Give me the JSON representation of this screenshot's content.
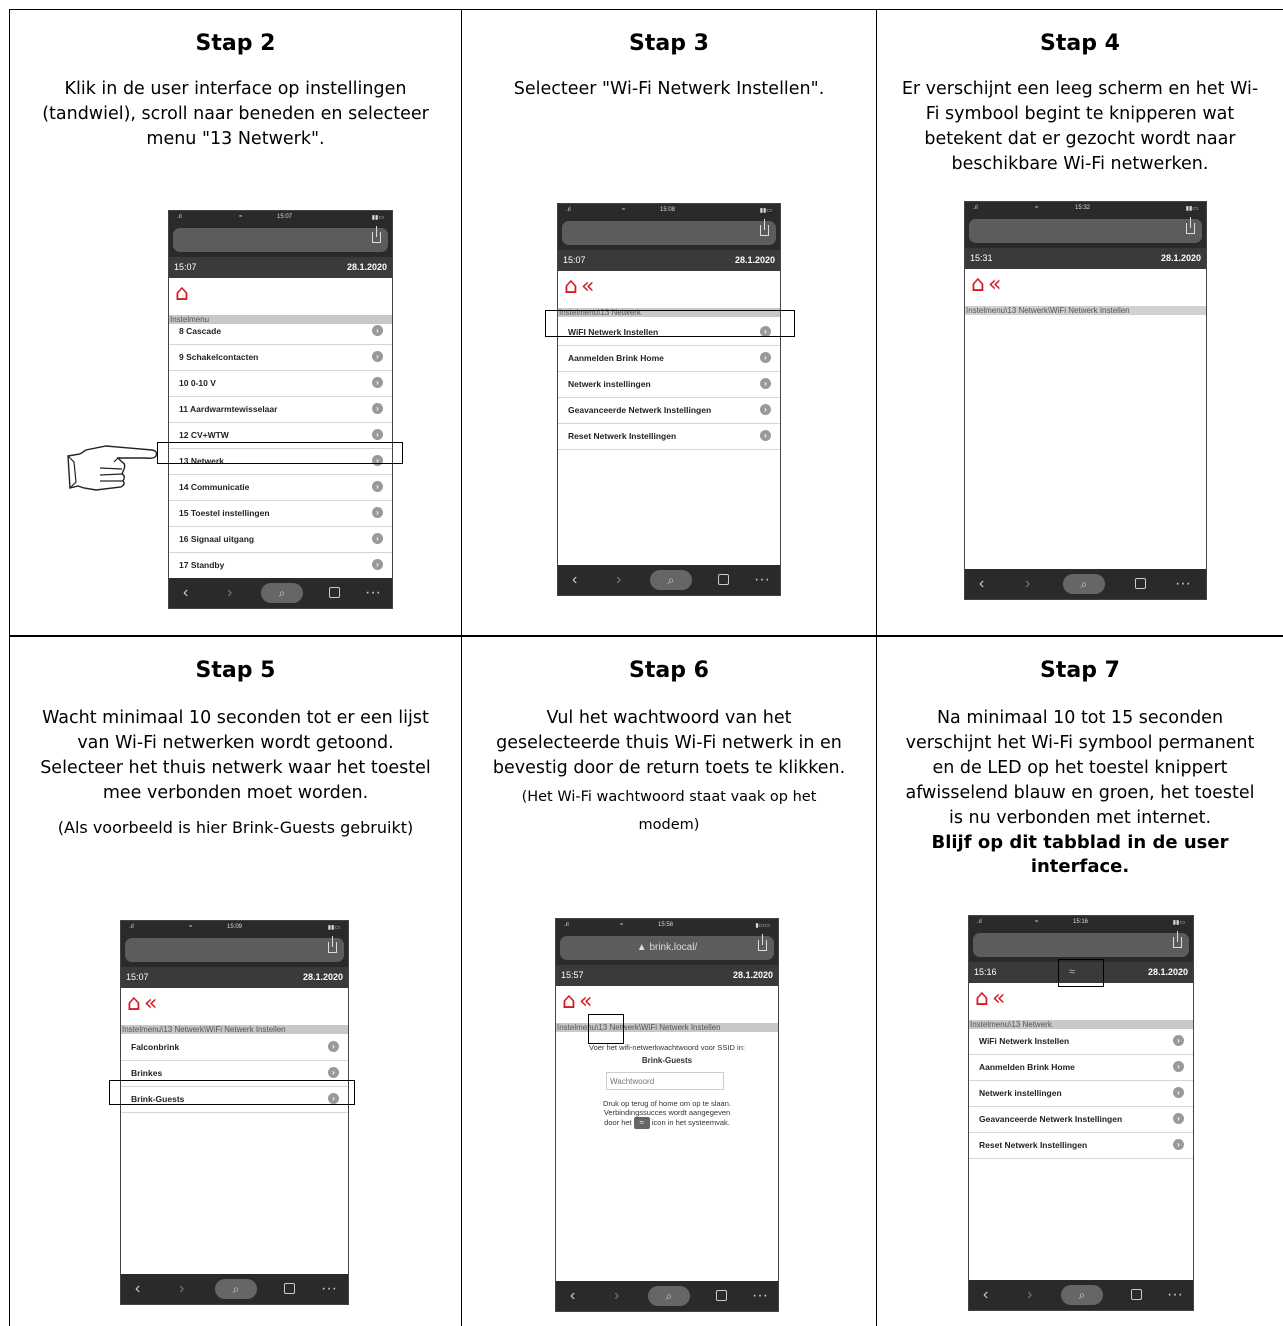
{
  "cells": [
    {
      "title": "Stap 2",
      "desc": [
        "Klik in de user interface op instellingen",
        "(tandwiel), scroll naar beneden en selecteer",
        "menu \"13 Netwerk\"."
      ],
      "phone": {
        "time": "15:07",
        "date": "28.1.2020",
        "status_time": "15:07",
        "breadcrumb": "Instelmenu",
        "items": [
          "8 Cascade",
          "9 Schakelcontacten",
          "10 0-10 V",
          "11 Aardwarmtewisselaar",
          "12 CV+WTW",
          "13 Netwerk",
          "14 Communicatie",
          "15 Toestel instellingen",
          "16 Signaal uitgang",
          "17 Standby"
        ]
      }
    },
    {
      "title": "Stap 3",
      "desc": [
        "Selecteer \"Wi-Fi Netwerk Instellen\"."
      ],
      "phone": {
        "time": "15:07",
        "date": "28.1.2020",
        "status_time": "15:08",
        "breadcrumb": "Instelmenu\\13 Netwerk",
        "items": [
          "WiFI Netwerk Instellen",
          "Aanmelden Brink Home",
          "Netwerk instellingen",
          "Geavanceerde Netwerk Instellingen",
          "Reset Netwerk Instellingen"
        ]
      }
    },
    {
      "title": "Stap 4",
      "desc": [
        "Er verschijnt een leeg scherm en het Wi-",
        "Fi symbool begint te knipperen wat",
        "betekent dat er gezocht wordt naar",
        "beschikbare Wi-Fi netwerken."
      ],
      "phone": {
        "time": "15:31",
        "date": "28.1.2020",
        "status_time": "15:32",
        "breadcrumb": "Instelmenu\\13 Netwerk\\WiFi Netwerk Instellen",
        "items": []
      }
    },
    {
      "title": "Stap 5",
      "desc": [
        "Wacht minimaal 10 seconden tot er een lijst",
        "van Wi-Fi netwerken wordt getoond.",
        "Selecteer het thuis netwerk waar het toestel",
        "mee verbonden moet worden."
      ],
      "note": "(Als voorbeeld is hier Brink-Guests gebruikt)",
      "phone": {
        "time": "15:07",
        "date": "28.1.2020",
        "status_time": "15:09",
        "breadcrumb": "Instelmenu\\13 Netwerk\\WiFi Netwerk Instellen",
        "items": [
          "Falconbrink",
          "Brinkes",
          "Brink-Guests"
        ]
      }
    },
    {
      "title": "Stap 6",
      "desc": [
        "Vul het wachtwoord van het",
        "geselecteerde thuis Wi-Fi netwerk in en",
        "bevestig door de return toets te klikken."
      ],
      "note": [
        "(Het Wi-Fi wachtwoord staat vaak op het",
        "modem)"
      ],
      "phone": {
        "url": "brink.local/",
        "time": "15:57",
        "date": "28.1.2020",
        "status_time": "15:58",
        "breadcrumb": "Instelmenu\\13 Netwerk\\WiFi Netwerk Instellen",
        "prompt": "Voer het wifi-netwerkwachtwoord voor SSID in:",
        "ssid": "Brink-Guests",
        "placeholder": "Wachtwoord",
        "info": [
          "Druk op terug of home om op te slaan.",
          "Verbindingssucces wordt aangegeven",
          "door het",
          "icon in het systeemvak."
        ]
      }
    },
    {
      "title": "Stap 7",
      "desc": [
        "Na minimaal 10 tot 15 seconden",
        "verschijnt het Wi-Fi symbool permanent",
        "en de LED op het toestel knippert",
        "afwisselend blauw en groen, het toestel",
        "is nu verbonden met internet."
      ],
      "bold": [
        "Blijf op dit tabblad in de user",
        "interface."
      ],
      "phone": {
        "time": "15:16",
        "date": "28.1.2020",
        "status_time": "15:16",
        "breadcrumb": "Instelmenu\\13 Netwerk",
        "items": [
          "WiFi Netwerk Instellen",
          "Aanmelden Brink Home",
          "Netwerk instellingen",
          "Geavanceerde Netwerk Instellingen",
          "Reset Netwerk Instellingen"
        ]
      }
    }
  ]
}
